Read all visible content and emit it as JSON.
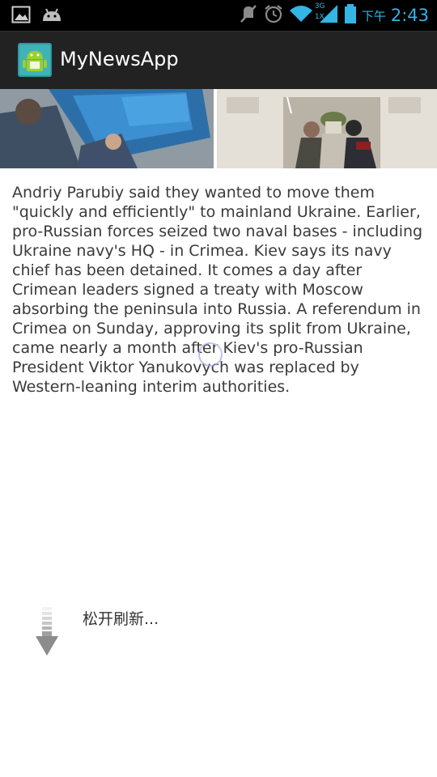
{
  "status_bar": {
    "ampm": "下午",
    "time": "2:43",
    "network_type": "3G",
    "signal_label": "1X",
    "accent_color": "#33b5e5",
    "icons": [
      "picture-icon",
      "android-notification-icon",
      "mute-icon",
      "alarm-icon",
      "wifi-icon",
      "signal-icon",
      "battery-icon"
    ]
  },
  "action_bar": {
    "title": "MyNewsApp",
    "background": "#222222"
  },
  "article": {
    "body": "Andriy Parubiy said they wanted to move them \"quickly and efficiently\" to mainland Ukraine. Earlier, pro-Russian forces seized two naval bases - including Ukraine navy's HQ - in Crimea. Kiev says its navy chief has been detained. It comes a day after Crimean leaders signed a treaty with Moscow absorbing the peninsula into Russia. A referendum in Crimea on Sunday, approving its split from Ukraine, came nearly a month after Kiev's pro-Russian President Viktor Yanukovych was replaced by Western-leaning interim authorities."
  },
  "pull_to_refresh": {
    "label": "松开刷新..."
  }
}
